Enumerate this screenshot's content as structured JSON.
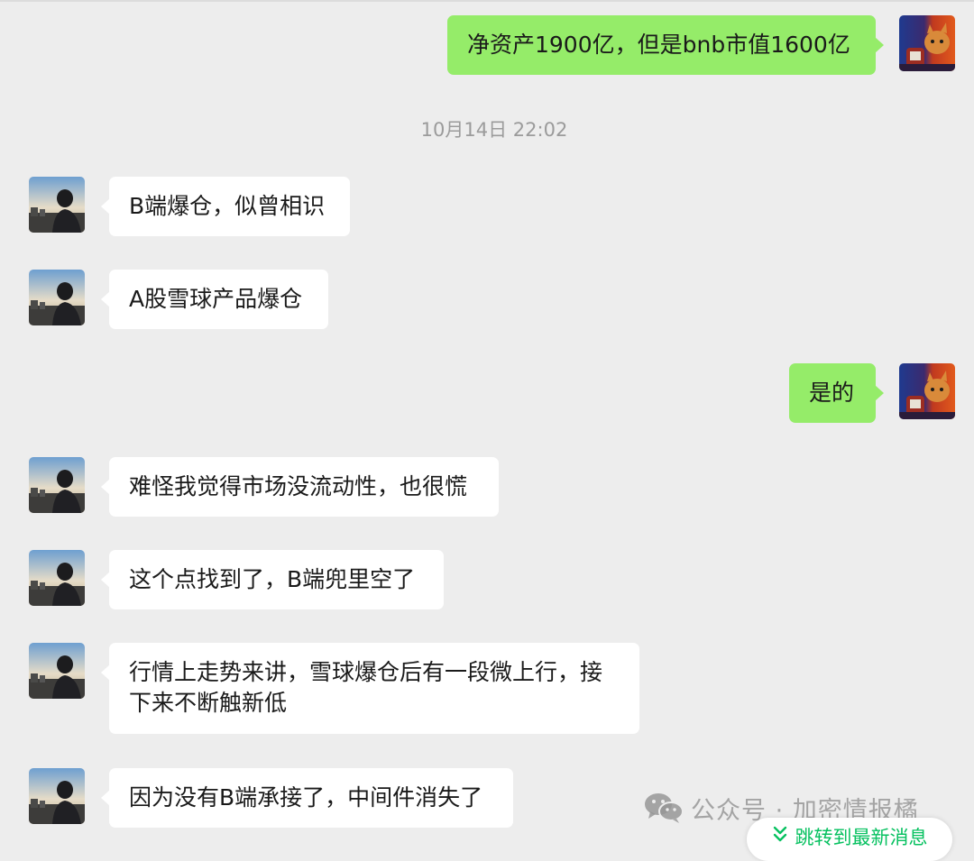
{
  "conversation": {
    "timestamp": "10月14日 22:02",
    "messages": [
      {
        "from": "self",
        "text": "净资产1900亿，但是bnb市值1600亿"
      },
      {
        "from": "other",
        "text": "B端爆仓，似曾相识"
      },
      {
        "from": "other",
        "text": "A股雪球产品爆仓"
      },
      {
        "from": "self",
        "text": "是的"
      },
      {
        "from": "other",
        "text": "难怪我觉得市场没流动性，也很慌"
      },
      {
        "from": "other",
        "text": "这个点找到了，B端兜里空了"
      },
      {
        "from": "other",
        "text": "行情上走势来讲，雪球爆仓后有一段微上行，接下来不断触新低"
      },
      {
        "from": "other",
        "text": "因为没有B端承接了，中间件消失了"
      }
    ]
  },
  "watermark": {
    "text": "公众号 · 加密情报橘",
    "icon": "wechat-logo-icon"
  },
  "jump_button": {
    "label": "跳转到最新消息",
    "icon": "double-chevron-down-icon"
  },
  "colors": {
    "background": "#ededed",
    "self_bubble": "#95ec69",
    "other_bubble": "#ffffff",
    "accent_green": "#07c160"
  }
}
